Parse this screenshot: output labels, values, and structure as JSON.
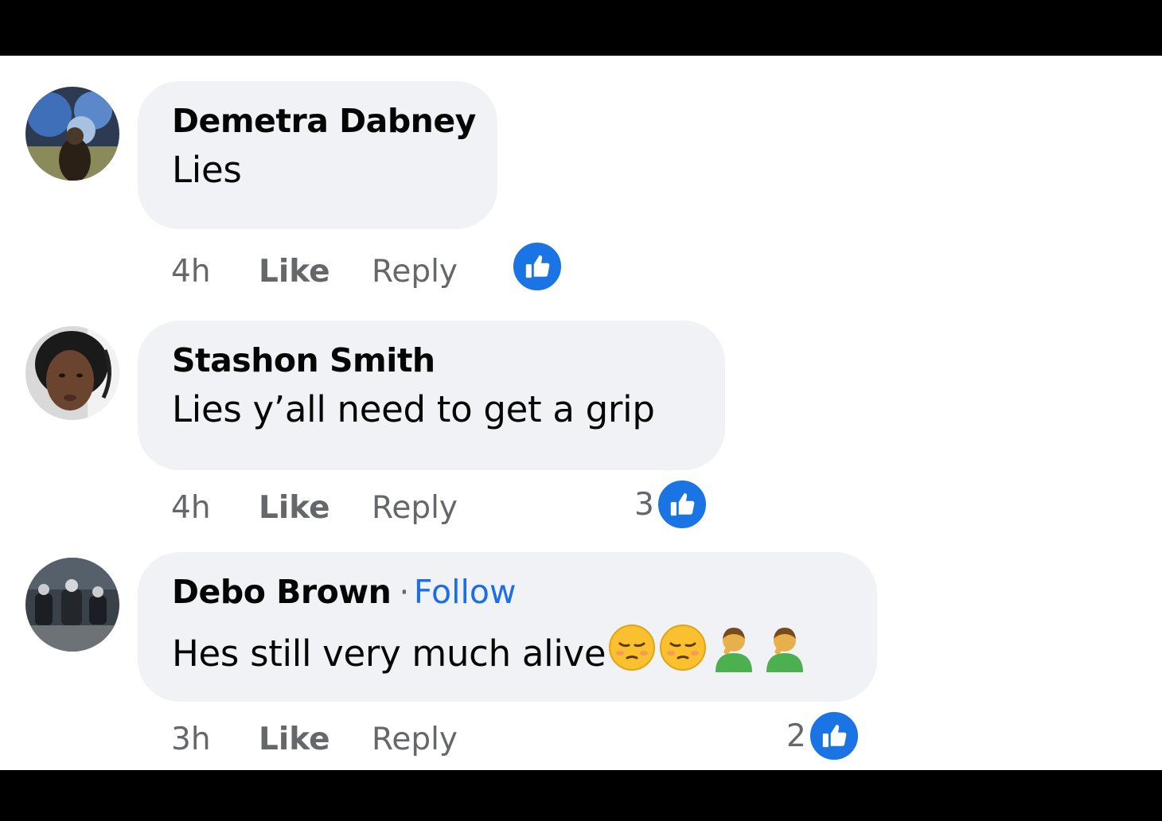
{
  "comments": [
    {
      "author": "Demetra Dabney",
      "text": "Lies",
      "time": "4h",
      "like_label": "Like",
      "reply_label": "Reply",
      "reaction_count": "",
      "reaction_icon": "like-icon"
    },
    {
      "author": "Stashon Smith",
      "text": "Lies y’all need to get a grip",
      "time": "4h",
      "like_label": "Like",
      "reply_label": "Reply",
      "reaction_count": "3",
      "reaction_icon": "like-icon"
    },
    {
      "author": "Debo Brown",
      "separator": "·",
      "follow_label": "Follow",
      "text": "Hes still very much alive",
      "emojis": [
        "pensive-face-icon",
        "pensive-face-icon",
        "person-facepalming-icon",
        "person-facepalming-icon"
      ],
      "time": "3h",
      "like_label": "Like",
      "reply_label": "Reply",
      "reaction_count": "2",
      "reaction_icon": "like-icon"
    }
  ],
  "colors": {
    "bubble": "#f0f2f5",
    "link": "#1b6dea",
    "reaction": "#1b74e4",
    "meta": "#65676b"
  }
}
